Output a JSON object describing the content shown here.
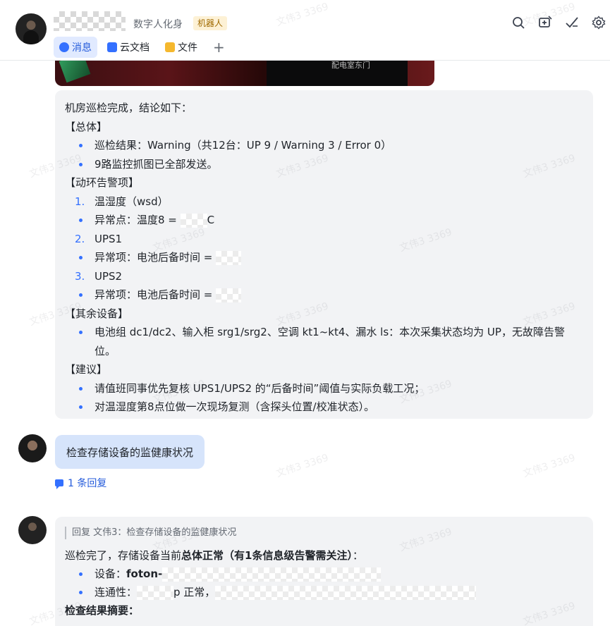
{
  "header": {
    "subtitle": "数字人化身",
    "badge": "机器人",
    "tabs": [
      {
        "label": "消息",
        "active": true
      },
      {
        "label": "云文档",
        "active": false
      },
      {
        "label": "文件",
        "active": false
      }
    ],
    "add_tab": "+",
    "icons": [
      "search-icon",
      "new-window-icon",
      "edit-check-icon",
      "settings-icon"
    ]
  },
  "photo": {
    "caption": "配电室东门"
  },
  "report": {
    "intro": "机房巡检完成，结论如下：",
    "s1": "【总体】",
    "s1_b1": "巡检结果：Warning（共12台：UP 9 / Warning 3 / Error 0）",
    "s1_b2": "9路监控抓图已全部发送。",
    "s2": "【动环告警项】",
    "n1": "1.",
    "n1_label": "温湿度（wsd）",
    "n1_b_pre": "异常点：温度8 = ",
    "n1_b_post": "C",
    "n2": "2.",
    "n2_label": "UPS1",
    "n2_b": "异常项：电池后备时间 = ",
    "n3": "3.",
    "n3_label": "UPS2",
    "n3_b": "异常项：电池后备时间 = ",
    "s3": "【其余设备】",
    "s3_b1": "电池组 dc1/dc2、输入柜 srg1/srg2、空调 kt1~kt4、漏水 ls：本次采集状态均为 UP，无故障告警位。",
    "s4": "【建议】",
    "s4_b1": "请值班同事优先复核 UPS1/UPS2 的“后备时间”阈值与实际负载工况；",
    "s4_b2": "对温湿度第8点位做一次现场复测（含探头位置/校准状态）。"
  },
  "query": {
    "text": "检查存储设备的监健康状况"
  },
  "reply_link": {
    "text": "1 条回复"
  },
  "answer": {
    "quote": "回复 文伟3：检查存储设备的监健康状况",
    "intro_pre": "巡检完了，存储设备当前",
    "intro_bold": "总体正常（有1条信息级告警需关注）",
    "intro_post": "：",
    "b1_label": "设备：",
    "b1_value": "foton-",
    "b2_label": "连通性：",
    "b2_mid": "p 正常，",
    "summary": "检查结果摘要："
  },
  "watermark": "文伟3 3369"
}
